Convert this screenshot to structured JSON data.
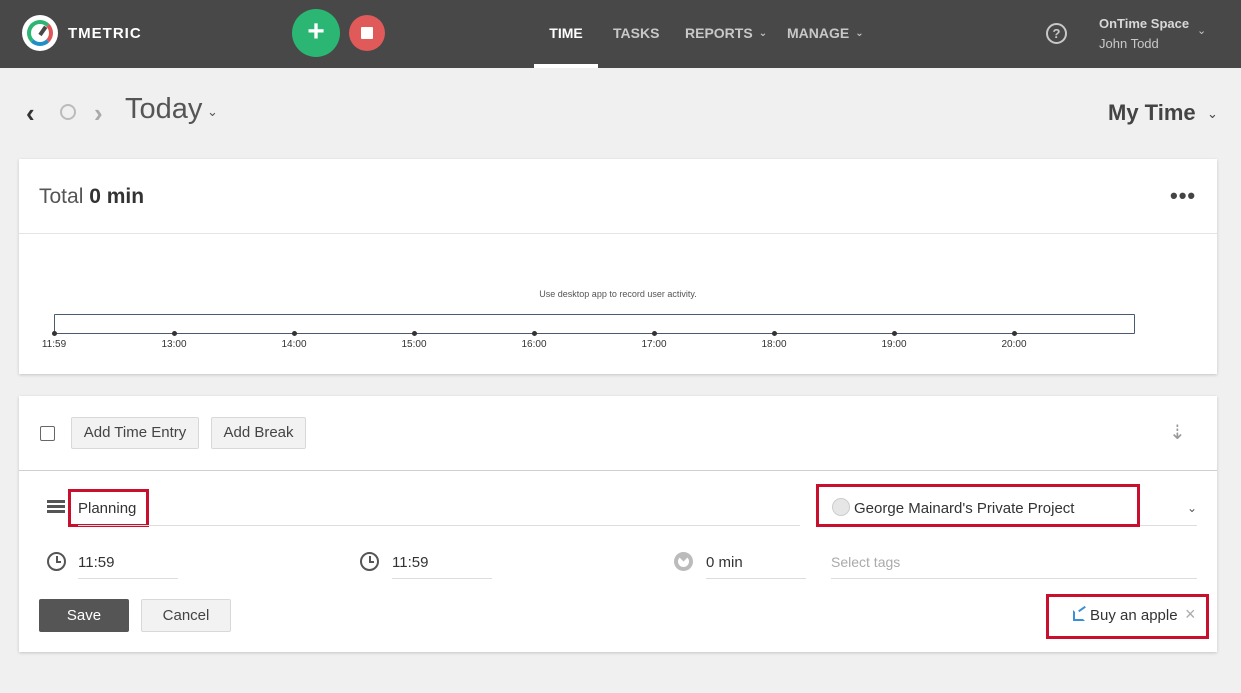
{
  "app": {
    "brand": "TMETRIC"
  },
  "toolbar": {
    "start_glyph": "+"
  },
  "nav": {
    "items": [
      {
        "label": "TIME",
        "active": true
      },
      {
        "label": "TASKS"
      },
      {
        "label": "REPORTS",
        "has_dropdown": true
      },
      {
        "label": "MANAGE",
        "has_dropdown": true
      }
    ],
    "chevron": "⌄",
    "help": "?"
  },
  "account": {
    "space": "OnTime Space",
    "user": "John Todd"
  },
  "date_nav": {
    "prev": "‹",
    "next": "›",
    "label": "Today",
    "chevron": "⌄"
  },
  "view": {
    "label": "My Time",
    "chevron": "⌄"
  },
  "total": {
    "prefix": "Total",
    "value": "0 min",
    "menu": "•••"
  },
  "timeline": {
    "message": "Use desktop app to record user activity.",
    "ticks": [
      "11:59",
      "13:00",
      "14:00",
      "15:00",
      "16:00",
      "17:00",
      "18:00",
      "19:00",
      "20:00"
    ]
  },
  "entries": {
    "add_time_entry": "Add Time Entry",
    "add_break": "Add Break",
    "sort_glyph": "⇣"
  },
  "entry_form": {
    "description": "Planning",
    "project": "George Mainard's Private Project",
    "project_chevron": "⌄",
    "start_time": "11:59",
    "end_time": "11:59",
    "duration": "0 min",
    "tags_placeholder": "Select tags",
    "save": "Save",
    "cancel": "Cancel",
    "external_link": "Buy an apple",
    "close": "×"
  },
  "colors": {
    "navbar": "#484848",
    "start": "#2bb673",
    "stop": "#e05a5a",
    "highlight": "#c8102e",
    "link_icon": "#3b8fd8"
  }
}
